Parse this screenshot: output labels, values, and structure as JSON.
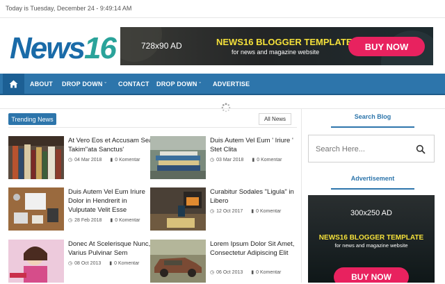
{
  "topbar": {
    "date_text": "Today is Tuesday, December 24 - 9:49:14 AM"
  },
  "logo": {
    "text": "News",
    "number": "16"
  },
  "header_banner": {
    "size_text": "728x90 AD",
    "title": "NEWS16 BLOGGER TEMPLATE",
    "subtitle": "for news and magazine website",
    "button": "BUY NOW"
  },
  "nav": {
    "home_icon": "home-icon",
    "items": [
      {
        "label": "ABOUT"
      },
      {
        "label": "DROP DOWN"
      },
      {
        "label": "CONTACT"
      },
      {
        "label": "DROP DOWN"
      },
      {
        "label": "ADVERTISE"
      }
    ]
  },
  "trending": {
    "badge": "Trending News",
    "all_button": "All News",
    "posts": [
      {
        "title": "At Vero Eos et Accusam Sea Takim\"ata Sanctus'",
        "date": "04 Mar 2018",
        "comments": "0 Komentar"
      },
      {
        "title": "Duis Autem Vel Eum ' Iriure ' Stet Clita",
        "date": "03 Mar 2018",
        "comments": "0 Komentar"
      },
      {
        "title": "Duis Autem Vel Eum Iriure Dolor in Hendrerit in Vulputate Velit Esse",
        "date": "28 Feb 2018",
        "comments": "0 Komentar"
      },
      {
        "title": "Curabitur Sodales \"Ligula\" in Libero",
        "date": "12 Oct 2017",
        "comments": "0 Komentar"
      },
      {
        "title": "Donec At Scelerisque Nunc, Varius Pulvinar Sem",
        "date": "08 Oct 2013",
        "comments": "0 Komentar"
      },
      {
        "title": "Lorem Ipsum Dolor Sit Amet, Consectetur Adipiscing Elit",
        "date": "06 Oct 2013",
        "comments": "0 Komentar"
      }
    ]
  },
  "sidebar": {
    "search_title": "Search Blog",
    "search_placeholder": "Search Here...",
    "ad_title": "Advertisement",
    "ad": {
      "size_text": "300x250 AD",
      "title": "NEWS16 BLOGGER TEMPLATE",
      "subtitle": "for news and magazine website",
      "button": "BUY NOW"
    }
  },
  "colors": {
    "brand_blue": "#2d75ab",
    "accent_pink": "#e8225f",
    "ad_yellow": "#f5e13a"
  }
}
